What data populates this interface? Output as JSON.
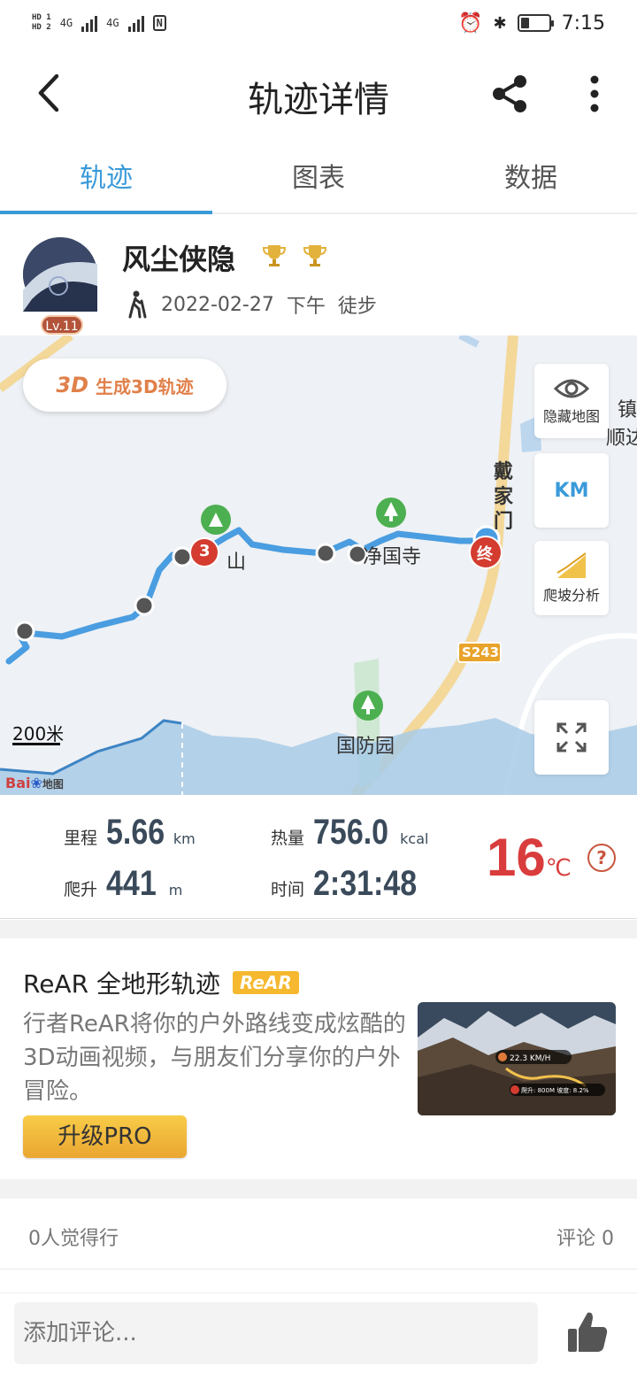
{
  "status_bar": {
    "hd1": "HD 1",
    "hd2": "HD 2",
    "net1": "4G",
    "net2": "4G",
    "nfc": "N",
    "time": "7:15",
    "battery_level": 0.3
  },
  "header": {
    "title": "轨迹详情"
  },
  "tabs": [
    {
      "label": "轨迹",
      "active": true
    },
    {
      "label": "图表",
      "active": false
    },
    {
      "label": "数据",
      "active": false
    }
  ],
  "profile": {
    "username": "风尘侠隐",
    "level": "Lv.11",
    "date": "2022-02-27",
    "period": "下午",
    "activity": "徒步"
  },
  "map": {
    "btn_3d_icon": "3D",
    "btn_3d_label": "生成3D轨迹",
    "hide_map_label": "隐藏地图",
    "km_label": "KM",
    "climb_label": "爬坡分析",
    "scale": "200米",
    "baidu": "Bai",
    "baidu_suffix": "地图",
    "places": {
      "mountain": "山",
      "temple": "净国寺",
      "park": "国防园",
      "town": "镇",
      "shunda": "顺达",
      "dai": "戴",
      "jia": "家",
      "men": "门",
      "road": "S243"
    },
    "marker_3": "3",
    "marker_end": "终",
    "colors": {
      "track": "#4a9de0",
      "marker_red": "#d33c2f",
      "poi_green": "#4caf50",
      "road": "#f3d89a"
    }
  },
  "stats": {
    "distance_label": "里程",
    "distance_value": "5.66",
    "distance_unit": "km",
    "climb_label": "爬升",
    "climb_value": "441",
    "climb_unit": "m",
    "calorie_label": "热量",
    "calorie_value": "756.0",
    "calorie_unit": "kcal",
    "time_label": "时间",
    "time_value": "2:31:48",
    "temperature": "16",
    "temperature_unit": "℃",
    "help": "?"
  },
  "rear": {
    "title": "ReAR 全地形轨迹",
    "badge": "ReAR",
    "description": "行者ReAR将你的户外路线变成炫酷的3D动画视频，与朋友们分享你的户外冒险。",
    "upgrade_label": "升级PRO",
    "preview_speed": "22.3 KM/H",
    "preview_stats": "爬升: 800M 坡度: 8.2%"
  },
  "social": {
    "likes": "0人觉得行",
    "comments": "评论 0"
  },
  "comment": {
    "placeholder": "添加评论..."
  }
}
